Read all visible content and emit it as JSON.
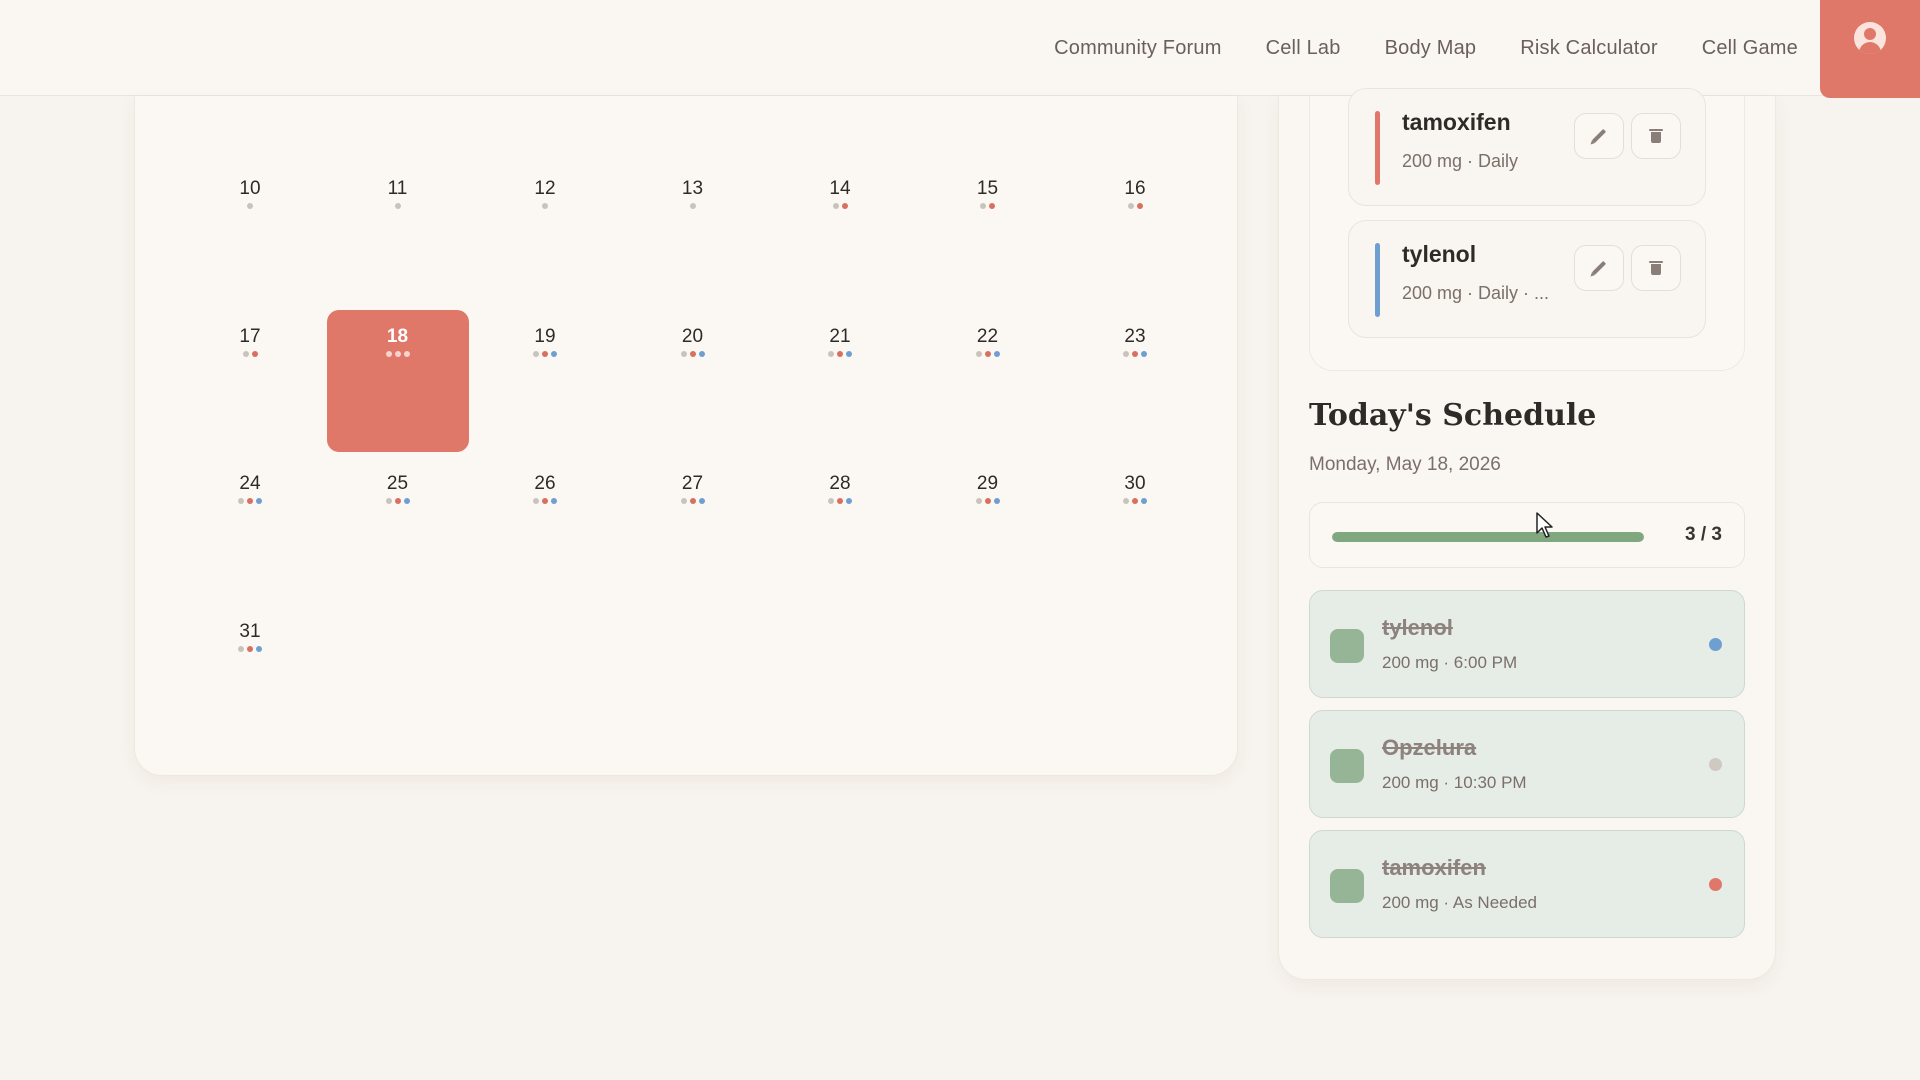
{
  "nav": {
    "links": [
      "Community Forum",
      "Cell Lab",
      "Body Map",
      "Risk Calculator",
      "Cell Game"
    ]
  },
  "profile": {
    "icon": "user-avatar-icon"
  },
  "calendar": {
    "selected_day": "18",
    "days": [
      {
        "num": "10",
        "dots": [
          "gray"
        ]
      },
      {
        "num": "11",
        "dots": [
          "gray"
        ]
      },
      {
        "num": "12",
        "dots": [
          "gray"
        ]
      },
      {
        "num": "13",
        "dots": [
          "gray"
        ]
      },
      {
        "num": "14",
        "dots": [
          "gray",
          "red"
        ]
      },
      {
        "num": "15",
        "dots": [
          "gray",
          "red"
        ]
      },
      {
        "num": "16",
        "dots": [
          "gray",
          "red"
        ]
      },
      {
        "num": "17",
        "dots": [
          "gray",
          "red"
        ]
      },
      {
        "num": "18",
        "dots": [
          "gray",
          "red",
          "blue"
        ]
      },
      {
        "num": "19",
        "dots": [
          "gray",
          "red",
          "blue"
        ]
      },
      {
        "num": "20",
        "dots": [
          "gray",
          "red",
          "blue"
        ]
      },
      {
        "num": "21",
        "dots": [
          "gray",
          "red",
          "blue"
        ]
      },
      {
        "num": "22",
        "dots": [
          "gray",
          "red",
          "blue"
        ]
      },
      {
        "num": "23",
        "dots": [
          "gray",
          "red",
          "blue"
        ]
      },
      {
        "num": "24",
        "dots": [
          "gray",
          "red",
          "blue"
        ]
      },
      {
        "num": "25",
        "dots": [
          "gray",
          "red",
          "blue"
        ]
      },
      {
        "num": "26",
        "dots": [
          "gray",
          "red",
          "blue"
        ]
      },
      {
        "num": "27",
        "dots": [
          "gray",
          "red",
          "blue"
        ]
      },
      {
        "num": "28",
        "dots": [
          "gray",
          "red",
          "blue"
        ]
      },
      {
        "num": "29",
        "dots": [
          "gray",
          "red",
          "blue"
        ]
      },
      {
        "num": "30",
        "dots": [
          "gray",
          "red",
          "blue"
        ]
      },
      {
        "num": "31",
        "dots": [
          "gray",
          "red",
          "blue"
        ]
      }
    ]
  },
  "medications": [
    {
      "name": "tamoxifen",
      "info": "200 mg · Daily",
      "color": "#e0786a"
    },
    {
      "name": "tylenol",
      "info": "200 mg · Daily · ...",
      "color": "#6f9fd1"
    }
  ],
  "schedule": {
    "title": "Today's Schedule",
    "date": "Monday, May 18, 2026",
    "progress": {
      "done": 3,
      "total": 3,
      "label": "3 / 3"
    },
    "items": [
      {
        "name": "tylenol",
        "info": "200 mg · 6:00 PM",
        "dot_color": "#6f9fd1"
      },
      {
        "name": "Opzelura",
        "info": "200 mg · 10:30 PM",
        "dot_color": "#cfc9c2"
      },
      {
        "name": "tamoxifen",
        "info": "200 mg · As Needed",
        "dot_color": "#e0786a"
      }
    ]
  },
  "colors": {
    "accent": "#e0786a",
    "blue": "#6f9fd1",
    "gray": "#c9c3bc",
    "done_green": "#96b596"
  }
}
